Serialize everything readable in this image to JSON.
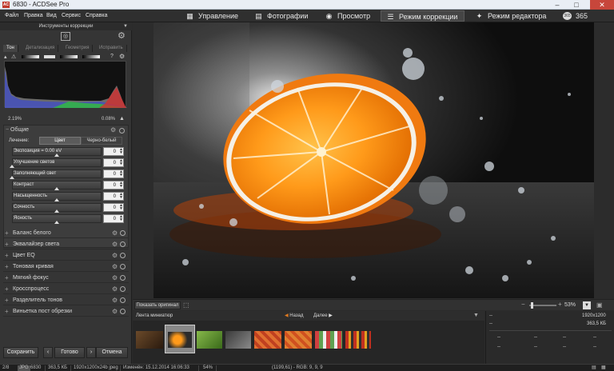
{
  "window": {
    "title": "6830 - ACDSee Pro",
    "app_badge": "AC"
  },
  "menu": [
    "Файл",
    "Правка",
    "Вид",
    "Сервис",
    "Справка"
  ],
  "modes": [
    {
      "label": "Управление",
      "icon": "grid-icon"
    },
    {
      "label": "Фотографии",
      "icon": "folder-icon"
    },
    {
      "label": "Просмотр",
      "icon": "eye-icon"
    },
    {
      "label": "Режим коррекции",
      "icon": "sliders-icon",
      "active": true
    },
    {
      "label": "Режим редактора",
      "icon": "wrench-icon"
    },
    {
      "label": "365",
      "icon": "365-badge-icon"
    }
  ],
  "left": {
    "panel_title": "Инструменты коррекции",
    "tabs": [
      "Тон",
      "Детализация",
      "Геометрия",
      "Исправить"
    ],
    "histogram": {
      "left_pct": "2.19%",
      "right_pct": "0.08%"
    },
    "general": {
      "title": "Общие",
      "processing_label": "Лечение:",
      "mode_color": "Цвет",
      "mode_bw": "Черно-белый",
      "sliders": [
        {
          "label": "Экспозиция = 0.00 eV",
          "value": "0",
          "pos": 0.5
        },
        {
          "label": "Улучшение светов",
          "value": "0",
          "pos": 0.0
        },
        {
          "label": "Заполняющий свет",
          "value": "0",
          "pos": 0.0
        },
        {
          "label": "Контраст",
          "value": "0",
          "pos": 0.5
        },
        {
          "label": "Насыщенность",
          "value": "0",
          "pos": 0.5
        },
        {
          "label": "Сочность",
          "value": "0",
          "pos": 0.5
        },
        {
          "label": "Ясность",
          "value": "0",
          "pos": 0.5
        }
      ]
    },
    "sections": [
      "Баланс белого",
      "Эквалайзер света",
      "Цвет EQ",
      "Тоновая кривая",
      "Мягкий фокус",
      "Кросспроцесс",
      "Разделитель тонов",
      "Виньетка пост обрезки"
    ],
    "buttons": {
      "save": "Сохранить",
      "done": "Готово",
      "cancel": "Отмена"
    }
  },
  "viewbar": {
    "show_original": "Показать оригинал",
    "zoom": "53%"
  },
  "filmstrip": {
    "title": "Лента миниатюр",
    "back": "Назад",
    "next": "Далее"
  },
  "info": {
    "dims": "1920x1200",
    "size": "363,5 КБ",
    "dash": "--"
  },
  "status": {
    "index": "2/8",
    "format": "JPG",
    "name": "6830",
    "size": "363,5 КБ",
    "dims": "1920x1200x24b jpeg",
    "modified": "Изменён: 15.12.2014 16:06:33",
    "zoom": "54%",
    "pixel": "(1199,61) - RGB: 9, 9, 9"
  }
}
